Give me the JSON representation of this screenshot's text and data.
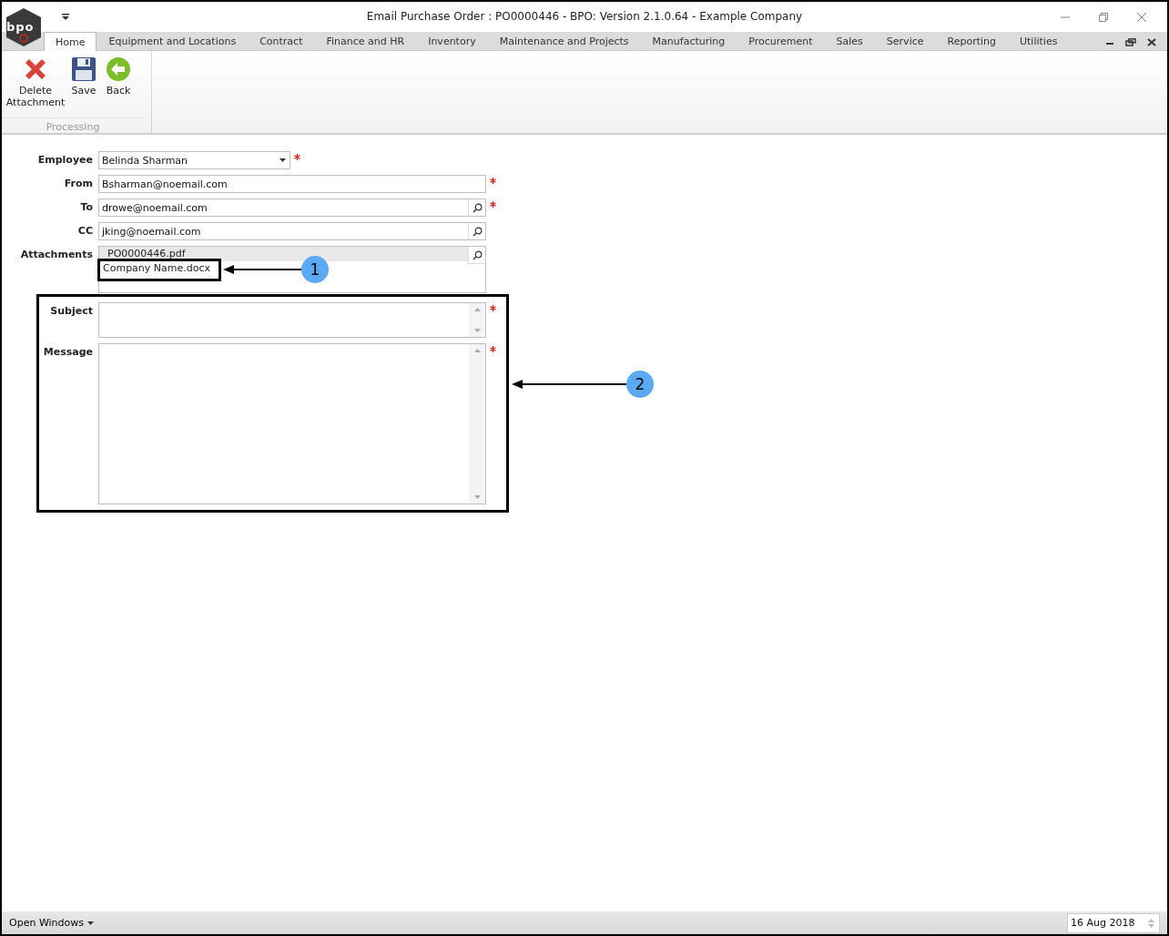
{
  "window": {
    "title": "Email Purchase Order : PO0000446 - BPO: Version 2.1.0.64 - Example Company",
    "logo_text": "bpo"
  },
  "tabs": [
    {
      "label": "Home",
      "selected": true
    },
    {
      "label": "Equipment and Locations",
      "selected": false
    },
    {
      "label": "Contract",
      "selected": false
    },
    {
      "label": "Finance and HR",
      "selected": false
    },
    {
      "label": "Inventory",
      "selected": false
    },
    {
      "label": "Maintenance and Projects",
      "selected": false
    },
    {
      "label": "Manufacturing",
      "selected": false
    },
    {
      "label": "Procurement",
      "selected": false
    },
    {
      "label": "Sales",
      "selected": false
    },
    {
      "label": "Service",
      "selected": false
    },
    {
      "label": "Reporting",
      "selected": false
    },
    {
      "label": "Utilities",
      "selected": false
    }
  ],
  "ribbon": {
    "group": "Processing",
    "buttons": [
      {
        "kind": "delete",
        "label": "Delete Attachment"
      },
      {
        "kind": "save",
        "label": "Save"
      },
      {
        "kind": "back",
        "label": "Back"
      }
    ]
  },
  "form": {
    "fields": [
      {
        "kind": "dropdown",
        "label": "Employee",
        "value": "Belinda Sharman",
        "required": true
      },
      {
        "kind": "text",
        "label": "From",
        "value": "Bsharman@noemail.com",
        "required": true
      },
      {
        "kind": "lookup",
        "label": "To",
        "value": "drowe@noemail.com",
        "required": true
      },
      {
        "kind": "lookup",
        "label": "CC",
        "value": "jking@noemail.com",
        "required": false
      },
      {
        "kind": "list",
        "label": "Attachments",
        "required": false,
        "items": [
          {
            "name": "PO0000446.pdf",
            "selected": true
          },
          {
            "name": "Company Name.docx",
            "selected": false
          }
        ]
      },
      {
        "kind": "memo",
        "label": "Subject",
        "required": true
      },
      {
        "kind": "memo",
        "label": "Message",
        "required": true
      }
    ]
  },
  "annotations": [
    {
      "number": "1"
    },
    {
      "number": "2"
    }
  ],
  "status_bar": {
    "menu": "Open Windows",
    "date": "16 Aug 2018"
  }
}
